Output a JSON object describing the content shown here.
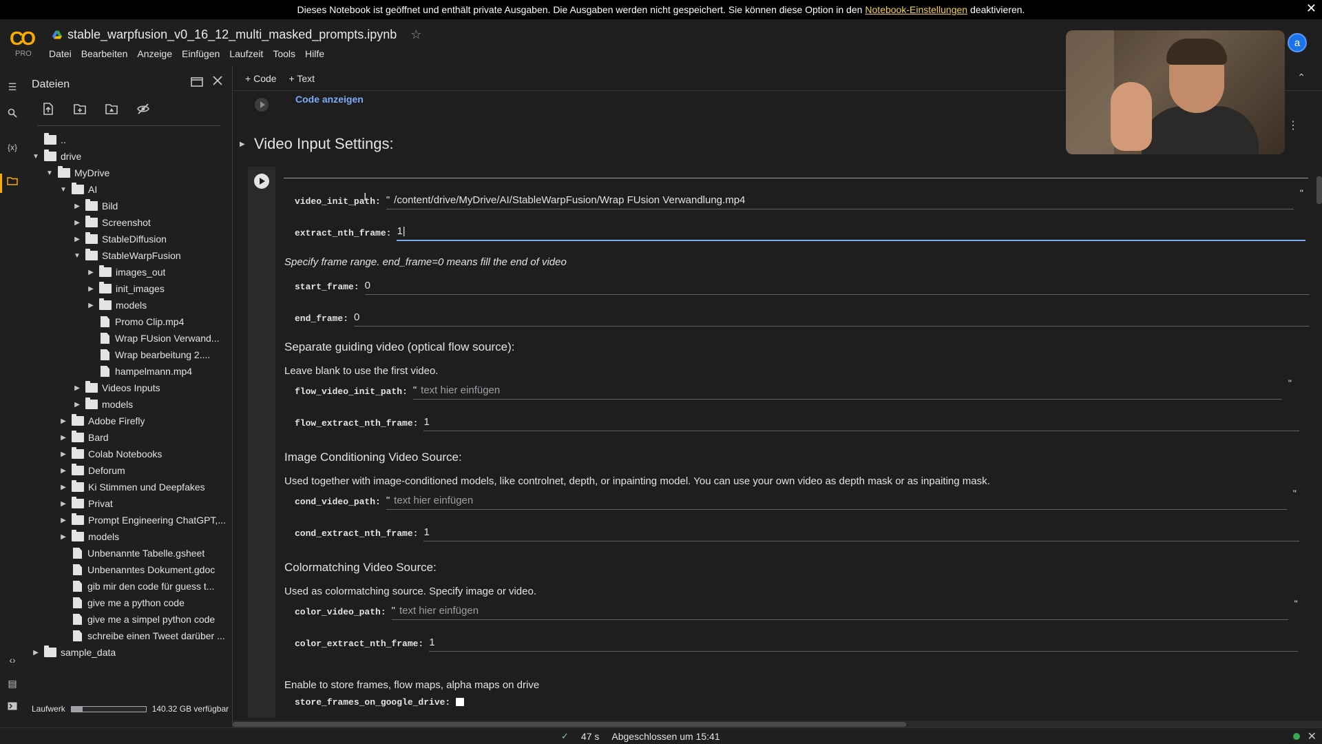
{
  "banner": {
    "text_before": "Dieses Notebook ist geöffnet und enthält private Ausgaben. Die Ausgaben werden nicht gespeichert. Sie können diese Option in den",
    "link": "Notebook-Einstellungen",
    "text_after": "deaktivieren.",
    "close": "✕"
  },
  "header": {
    "logo": "CO",
    "tier": "PRO",
    "title": "stable_warpfusion_v0_16_12_multi_masked_prompts.ipynb",
    "star": "☆",
    "avatar": "a",
    "menu": [
      "Datei",
      "Bearbeiten",
      "Anzeige",
      "Einfügen",
      "Laufzeit",
      "Tools",
      "Hilfe"
    ]
  },
  "files_panel": {
    "title": "Dateien",
    "disk_label": "Laufwerk",
    "disk_free": "140.32 GB verfügbar",
    "disk_used_fraction": 0.15,
    "tree": [
      {
        "label": "..",
        "type": "up",
        "depth": 0,
        "caret": ""
      },
      {
        "label": "drive",
        "type": "folder",
        "depth": 0,
        "caret": "open"
      },
      {
        "label": "MyDrive",
        "type": "folder",
        "depth": 1,
        "caret": "open"
      },
      {
        "label": "AI",
        "type": "folder",
        "depth": 2,
        "caret": "open"
      },
      {
        "label": "Bild",
        "type": "folder",
        "depth": 3,
        "caret": "closed"
      },
      {
        "label": "Screenshot",
        "type": "folder",
        "depth": 3,
        "caret": "closed"
      },
      {
        "label": "StableDiffusion",
        "type": "folder",
        "depth": 3,
        "caret": "closed"
      },
      {
        "label": "StableWarpFusion",
        "type": "folder",
        "depth": 3,
        "caret": "open"
      },
      {
        "label": "images_out",
        "type": "folder",
        "depth": 4,
        "caret": "closed"
      },
      {
        "label": "init_images",
        "type": "folder",
        "depth": 4,
        "caret": "closed"
      },
      {
        "label": "models",
        "type": "folder",
        "depth": 4,
        "caret": "closed"
      },
      {
        "label": "Promo Clip.mp4",
        "type": "file",
        "depth": 4,
        "caret": ""
      },
      {
        "label": "Wrap FUsion Verwand...",
        "type": "file",
        "depth": 4,
        "caret": ""
      },
      {
        "label": "Wrap bearbeitung 2....",
        "type": "file",
        "depth": 4,
        "caret": ""
      },
      {
        "label": "hampelmann.mp4",
        "type": "file",
        "depth": 4,
        "caret": ""
      },
      {
        "label": "Videos Inputs",
        "type": "folder",
        "depth": 3,
        "caret": "closed"
      },
      {
        "label": "models",
        "type": "folder",
        "depth": 3,
        "caret": "closed"
      },
      {
        "label": "Adobe Firefly",
        "type": "folder",
        "depth": 2,
        "caret": "closed"
      },
      {
        "label": "Bard",
        "type": "folder",
        "depth": 2,
        "caret": "closed"
      },
      {
        "label": "Colab Notebooks",
        "type": "folder",
        "depth": 2,
        "caret": "closed"
      },
      {
        "label": "Deforum",
        "type": "folder",
        "depth": 2,
        "caret": "closed"
      },
      {
        "label": "Ki Stimmen und Deepfakes",
        "type": "folder",
        "depth": 2,
        "caret": "closed"
      },
      {
        "label": "Privat",
        "type": "folder",
        "depth": 2,
        "caret": "closed"
      },
      {
        "label": "Prompt Engineering ChatGPT,...",
        "type": "folder",
        "depth": 2,
        "caret": "closed"
      },
      {
        "label": "models",
        "type": "folder",
        "depth": 2,
        "caret": "closed"
      },
      {
        "label": "Unbenannte Tabelle.gsheet",
        "type": "file",
        "depth": 2,
        "caret": ""
      },
      {
        "label": "Unbenanntes Dokument.gdoc",
        "type": "file",
        "depth": 2,
        "caret": ""
      },
      {
        "label": "gib mir den code für guess t...",
        "type": "file",
        "depth": 2,
        "caret": ""
      },
      {
        "label": "give me a python code",
        "type": "file",
        "depth": 2,
        "caret": ""
      },
      {
        "label": "give me a simpel python code",
        "type": "file",
        "depth": 2,
        "caret": ""
      },
      {
        "label": "schreibe einen Tweet darüber ...",
        "type": "file",
        "depth": 2,
        "caret": ""
      },
      {
        "label": "sample_data",
        "type": "folder",
        "depth": 0,
        "caret": "closed"
      }
    ]
  },
  "toolbar": {
    "code": "Code",
    "text": "Text"
  },
  "main": {
    "code_show": "Code anzeigen",
    "section_title": "Video Input Settings:",
    "params": {
      "video_init_path": {
        "name": "video_init_path:",
        "value": "/content/drive/MyDrive/AI/StableWarpFusion/Wrap FUsion Verwandlung.mp4"
      },
      "extract_nth_frame": {
        "name": "extract_nth_frame:",
        "value": "1"
      },
      "start_frame": {
        "name": "start_frame:",
        "value": "0"
      },
      "end_frame": {
        "name": "end_frame:",
        "value": "0"
      },
      "flow_video_init_path": {
        "name": "flow_video_init_path:",
        "placeholder": "text hier einfügen"
      },
      "flow_extract_nth_frame": {
        "name": "flow_extract_nth_frame:",
        "value": "1"
      },
      "cond_video_path": {
        "name": "cond_video_path:",
        "placeholder": "text hier einfügen"
      },
      "cond_extract_nth_frame": {
        "name": "cond_extract_nth_frame:",
        "value": "1"
      },
      "color_video_path": {
        "name": "color_video_path:",
        "placeholder": "text hier einfügen"
      },
      "color_extract_nth_frame": {
        "name": "color_extract_nth_frame:",
        "value": "1"
      },
      "store_frames_on_google_drive": {
        "name": "store_frames_on_google_drive:"
      }
    },
    "md": {
      "frame_range": "Specify frame range. end_frame=0 means fill the end of video",
      "sep_heading": "Separate guiding video (optical flow source):",
      "sep_text": "Leave blank to use the first video.",
      "cond_heading": "Image Conditioning Video Source:",
      "cond_text": "Used together with image-conditioned models, like controlnet, depth, or inpainting model. You can use your own video as depth mask or as inpaiting mask.",
      "color_heading": "Colormatching Video Source:",
      "color_text": "Used as colormatching source. Specify image or video.",
      "store_text": "Enable to store frames, flow maps, alpha maps on drive"
    }
  },
  "status": {
    "check": "✓",
    "duration": "47 s",
    "completed": "Abgeschlossen um 15:41",
    "close": "✕"
  },
  "colors": {
    "accent": "#f9ab00",
    "link": "#7cacf8",
    "banner_link": "#f6d34a",
    "ok": "#34a853"
  }
}
